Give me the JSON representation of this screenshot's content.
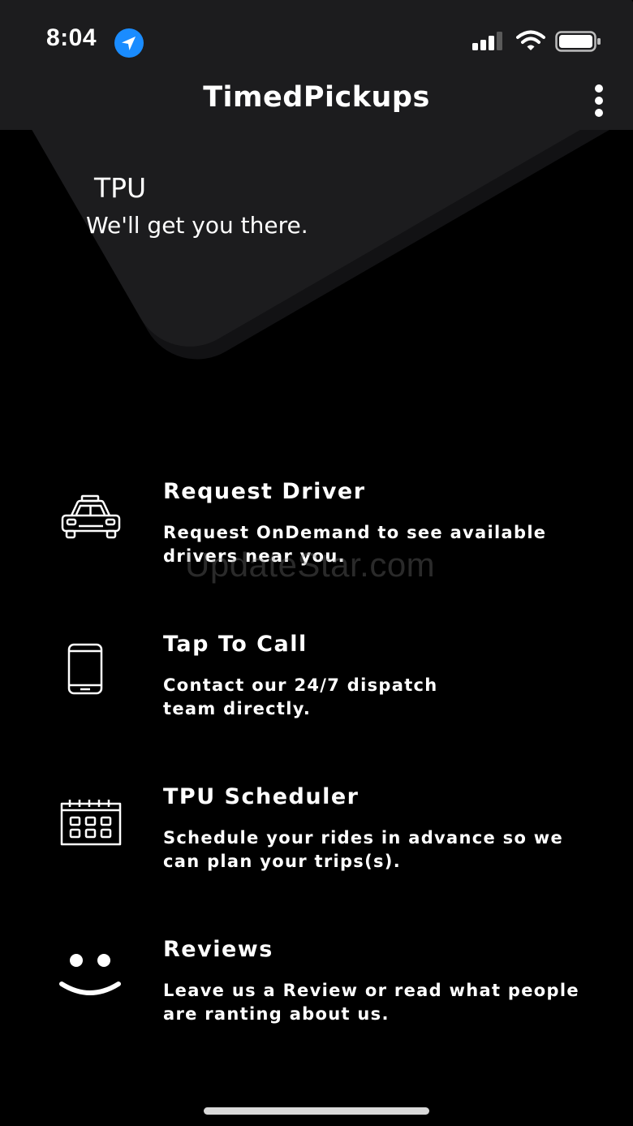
{
  "status_bar": {
    "time": "8:04"
  },
  "header": {
    "title": "TimedPickups"
  },
  "hero": {
    "title": "TPU",
    "subtitle": "We'll get you there."
  },
  "menu": {
    "items": [
      {
        "title": "Request Driver",
        "description": "Request OnDemand to see available drivers near you.",
        "icon": "car-icon"
      },
      {
        "title": "Tap To Call",
        "description": "Contact our 24/7 dispatch team directly.",
        "icon": "phone-icon"
      },
      {
        "title": "TPU Scheduler",
        "description": "Schedule your rides in advance so we can plan your trips(s).",
        "icon": "calendar-icon"
      },
      {
        "title": "Reviews",
        "description": "Leave us a Review or read what people are ranting about us.",
        "icon": "smiley-icon"
      }
    ]
  },
  "watermark": "UpdateStar.com",
  "colors": {
    "background": "#000000",
    "card": "#1c1c1e",
    "text": "#ffffff",
    "location_accent": "#1a8cff"
  }
}
